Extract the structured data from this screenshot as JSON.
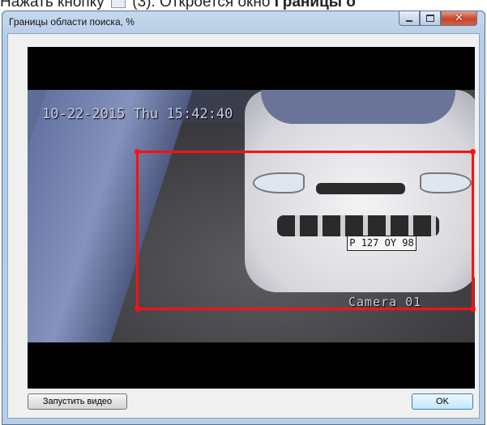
{
  "background_doc": {
    "text_before": "Нажать кнопку",
    "icon": "roi-icon",
    "text_middle": "(3). Откроется окно",
    "text_bold": "Границы о"
  },
  "window": {
    "title": "Границы области поиска, %",
    "controls": {
      "minimize": "minimize-icon",
      "maximize": "maximize-icon",
      "close": "close-icon"
    }
  },
  "video": {
    "osd_timestamp": "10-22-2015 Thu 15:42:40",
    "osd_camera": "Camera 01",
    "plate_text": "P 127 OY 98"
  },
  "buttons": {
    "start_video": "Запустить видео",
    "ok": "OK"
  },
  "colors": {
    "roi_border": "#ff1010",
    "title_bar": "#b3cbe6",
    "close_button": "#c7452a"
  }
}
